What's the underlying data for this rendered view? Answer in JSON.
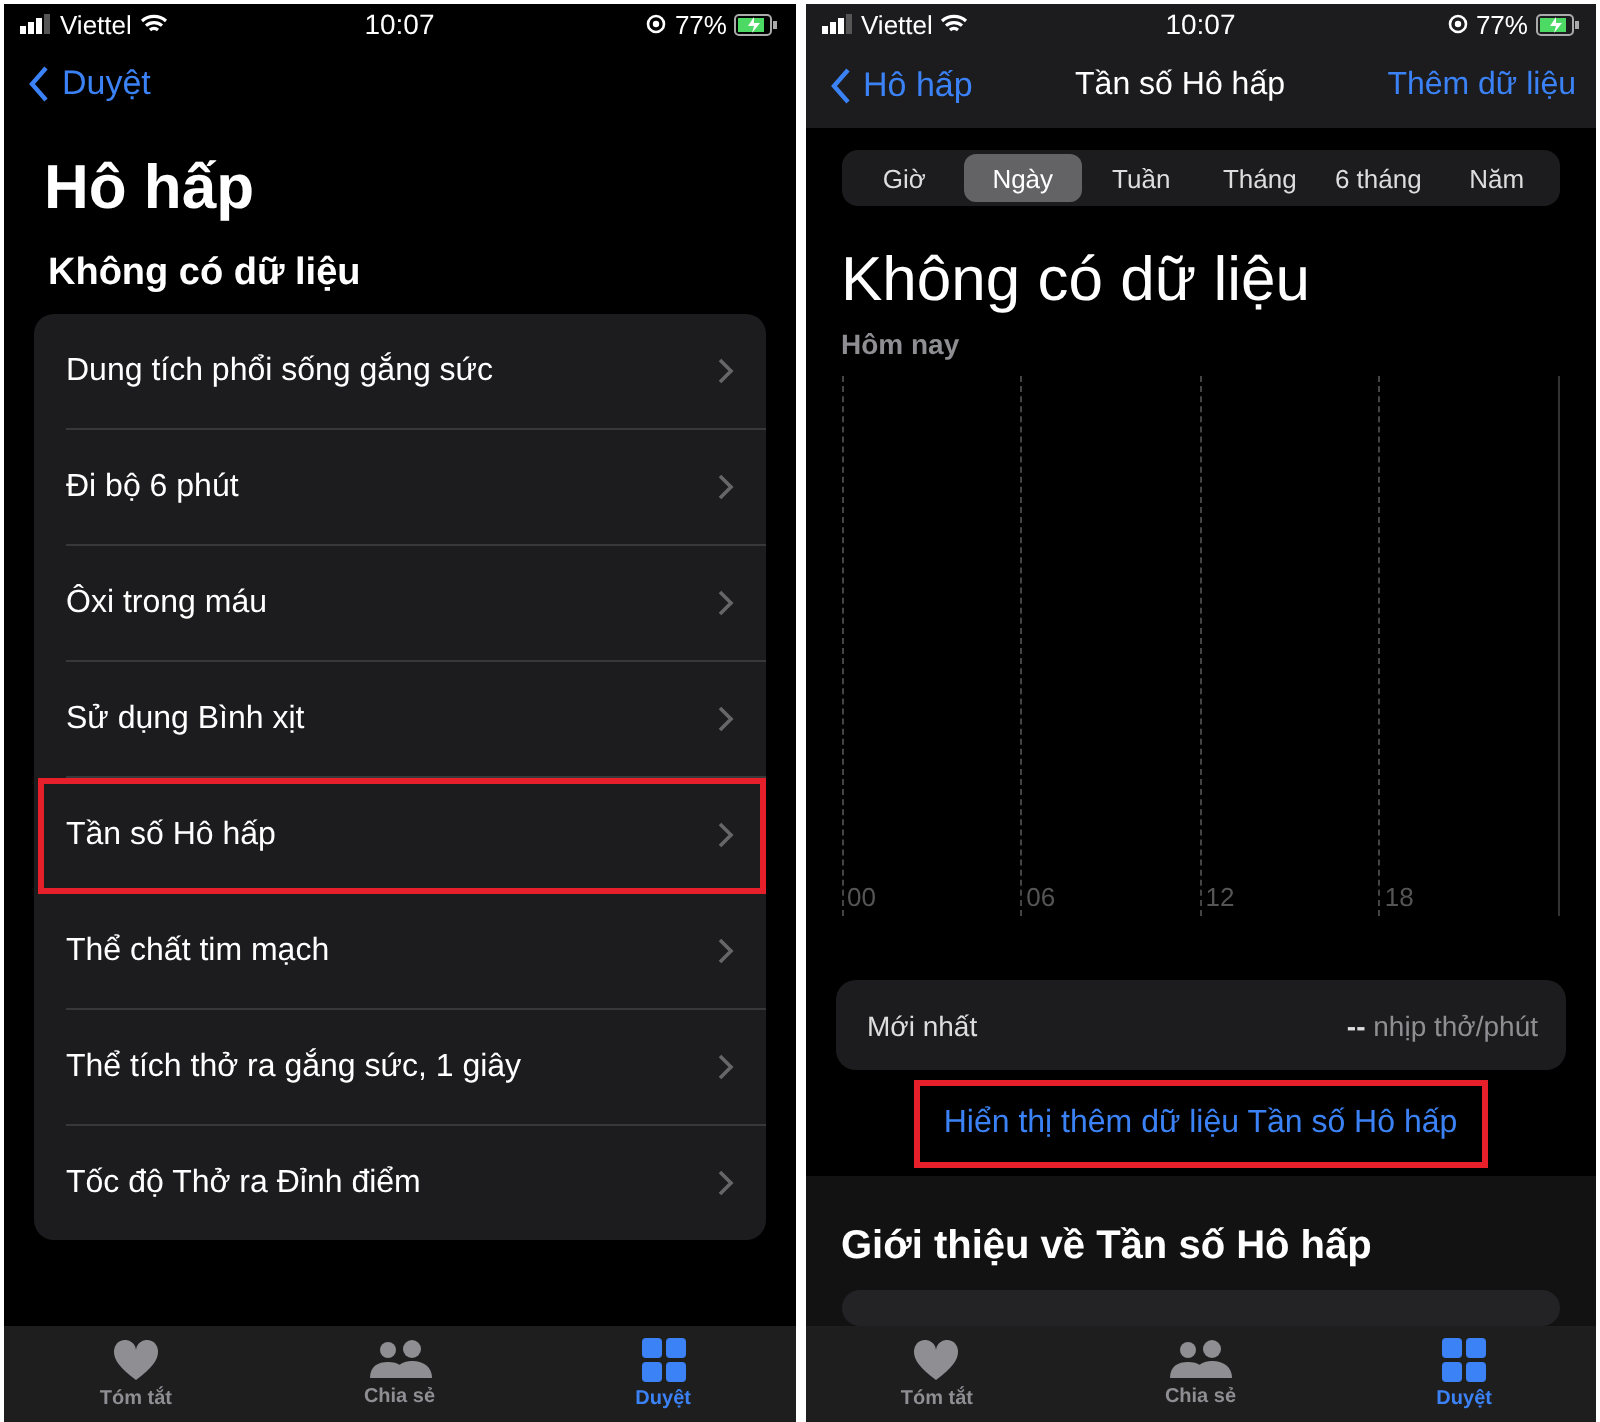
{
  "screens": [
    {
      "status_bar": {
        "carrier": "Viettel",
        "time": "10:07",
        "battery": "77%"
      },
      "nav": {
        "back": "Duyệt"
      },
      "title": "Hô hấp",
      "section": "Không có dữ liệu",
      "items": [
        {
          "label": "Dung tích phổi sống gắng sức",
          "highlighted": false
        },
        {
          "label": "Đi bộ 6 phút",
          "highlighted": false
        },
        {
          "label": "Ôxi trong máu",
          "highlighted": false
        },
        {
          "label": "Sử dụng Bình xịt",
          "highlighted": false
        },
        {
          "label": "Tần số Hô hấp",
          "highlighted": true
        },
        {
          "label": "Thể chất tim mạch",
          "highlighted": false
        },
        {
          "label": "Thể tích thở ra gắng sức, 1 giây",
          "highlighted": false
        },
        {
          "label": "Tốc độ Thở ra Đỉnh điểm",
          "highlighted": false
        }
      ],
      "tab_bar": [
        {
          "label": "Tóm tắt",
          "kind": "heart",
          "selected": false
        },
        {
          "label": "Chia sẻ",
          "kind": "people",
          "selected": false
        },
        {
          "label": "Duyệt",
          "kind": "grid",
          "selected": true
        }
      ]
    },
    {
      "status_bar": {
        "carrier": "Viettel",
        "time": "10:07",
        "battery": "77%"
      },
      "nav": {
        "back": "Hô hấp",
        "title": "Tần số Hô hấp",
        "action": "Thêm dữ liệu"
      },
      "segments": [
        {
          "label": "Giờ",
          "selected": false
        },
        {
          "label": "Ngày",
          "selected": true
        },
        {
          "label": "Tuần",
          "selected": false
        },
        {
          "label": "Tháng",
          "selected": false
        },
        {
          "label": "6 tháng",
          "selected": false
        },
        {
          "label": "Năm",
          "selected": false
        }
      ],
      "headline": "Không có dữ liệu",
      "subtitle": "Hôm nay",
      "chart_axis": [
        "00",
        "06",
        "12",
        "18"
      ],
      "latest": {
        "label": "Mới nhất",
        "value": "--",
        "unit": "nhịp thở/phút"
      },
      "link": {
        "label": "Hiển thị thêm dữ liệu Tần số Hô hấp",
        "highlighted": true
      },
      "about_header": "Giới thiệu về Tần số Hô hấp",
      "tab_bar": [
        {
          "label": "Tóm tắt",
          "kind": "heart",
          "selected": false
        },
        {
          "label": "Chia sẻ",
          "kind": "people",
          "selected": false
        },
        {
          "label": "Duyệt",
          "kind": "grid",
          "selected": true
        }
      ]
    }
  ]
}
